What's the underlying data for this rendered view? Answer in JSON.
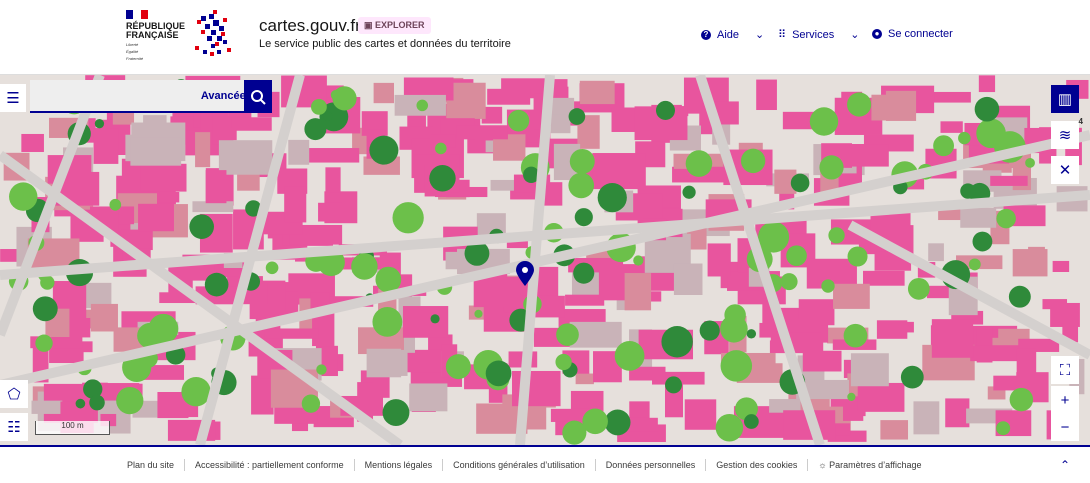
{
  "header": {
    "gov_name": "RÉPUBLIQUE FRANÇAISE",
    "motto": [
      "Liberté",
      "Égalité",
      "Fraternité"
    ],
    "site_title": "cartes.gouv.fr",
    "badge": "EXPLORER",
    "tagline": "Le service public des cartes et données du territoire",
    "nav": [
      {
        "label": "Aide",
        "icon": "question-circle-icon"
      },
      {
        "label": "Services",
        "icon": "grid-icon"
      },
      {
        "label": "Se connecter",
        "icon": "user-circle-icon"
      }
    ]
  },
  "map": {
    "search": {
      "value": "",
      "advanced_label": "Avancée"
    },
    "layers_count": "4",
    "scale_label": "100 m",
    "colors": {
      "buildings": "#e8559e",
      "roads": "#d4d0ce",
      "vegetation": "#6cc04a",
      "accent": "#000091"
    }
  },
  "footer": {
    "links": [
      "Plan du site",
      "Accessibilité : partiellement conforme",
      "Mentions légales",
      "Conditions générales d’utilisation",
      "Données personnelles",
      "Gestion des cookies",
      "Paramètres d’affichage"
    ]
  }
}
